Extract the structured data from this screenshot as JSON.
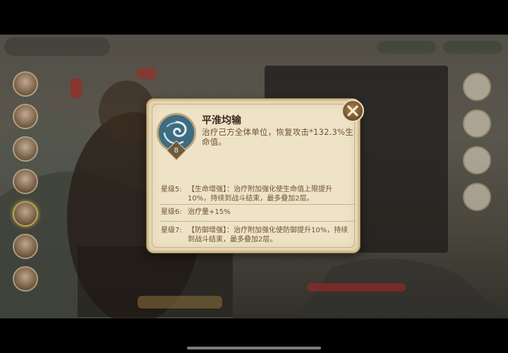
{
  "skill": {
    "name": "平淮均输",
    "description": "治疗己方全体单位，恢复攻击*132.3%生命值。",
    "level": "8",
    "icon": "swirl-skill-icon"
  },
  "star_bonuses": [
    {
      "label": "星级5:",
      "text": "【生命增强】：治疗附加强化使生命值上限提升10%，持续到战斗结束，最多叠加2层。"
    },
    {
      "label": "星级6:",
      "text": "治疗量+15%"
    },
    {
      "label": "星级7:",
      "text": "【防御增强】：治疗附加强化使防御提升10%，持续到战斗结束，最多叠加2层。"
    }
  ],
  "colors": {
    "card_bg": "#efe3c7",
    "card_border": "#d2bb8e",
    "text_main": "#6e5232",
    "title": "#3b2e22"
  }
}
